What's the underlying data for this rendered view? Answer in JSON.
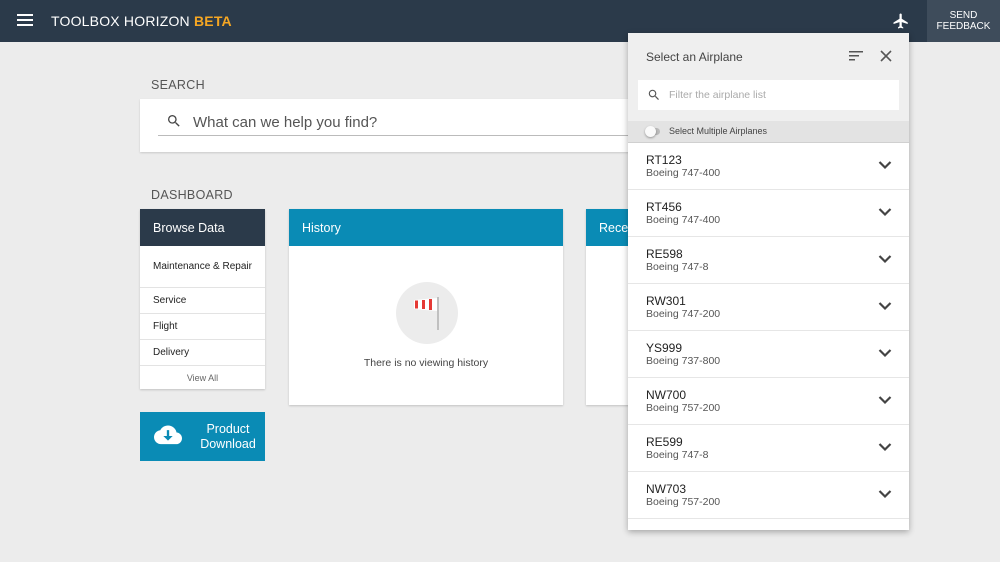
{
  "header": {
    "app_name": "TOOLBOX HORIZON",
    "beta_label": "BETA",
    "feedback_line1": "SEND",
    "feedback_line2": "FEEDBACK",
    "accent_color": "#f5a623",
    "bar_color": "#2b3a4a"
  },
  "search": {
    "label": "SEARCH",
    "placeholder": "What can we help you find?"
  },
  "dashboard": {
    "label": "DASHBOARD",
    "browse": {
      "title": "Browse Data",
      "items": [
        "Maintenance & Repair",
        "Service",
        "Flight",
        "Delivery"
      ],
      "view_all": "View All"
    },
    "download": {
      "line1": "Product",
      "line2": "Download"
    },
    "history": {
      "title": "History",
      "empty_text": "There is no viewing history"
    },
    "recent": {
      "title": "Recently Viewed"
    },
    "card_color": "#0a8bb5"
  },
  "airplane_panel": {
    "title": "Select an Airplane",
    "filter_placeholder": "Filter the airplane list",
    "multi_select_label": "Select Multiple Airplanes",
    "multi_select_on": false,
    "airplanes": [
      {
        "code": "RT123",
        "model": "Boeing 747-400"
      },
      {
        "code": "RT456",
        "model": "Boeing 747-400"
      },
      {
        "code": "RE598",
        "model": "Boeing 747-8"
      },
      {
        "code": "RW301",
        "model": "Boeing 747-200"
      },
      {
        "code": "YS999",
        "model": "Boeing 737-800"
      },
      {
        "code": "NW700",
        "model": "Boeing 757-200"
      },
      {
        "code": "RE599",
        "model": "Boeing 747-8"
      },
      {
        "code": "NW703",
        "model": "Boeing 757-200"
      }
    ]
  }
}
